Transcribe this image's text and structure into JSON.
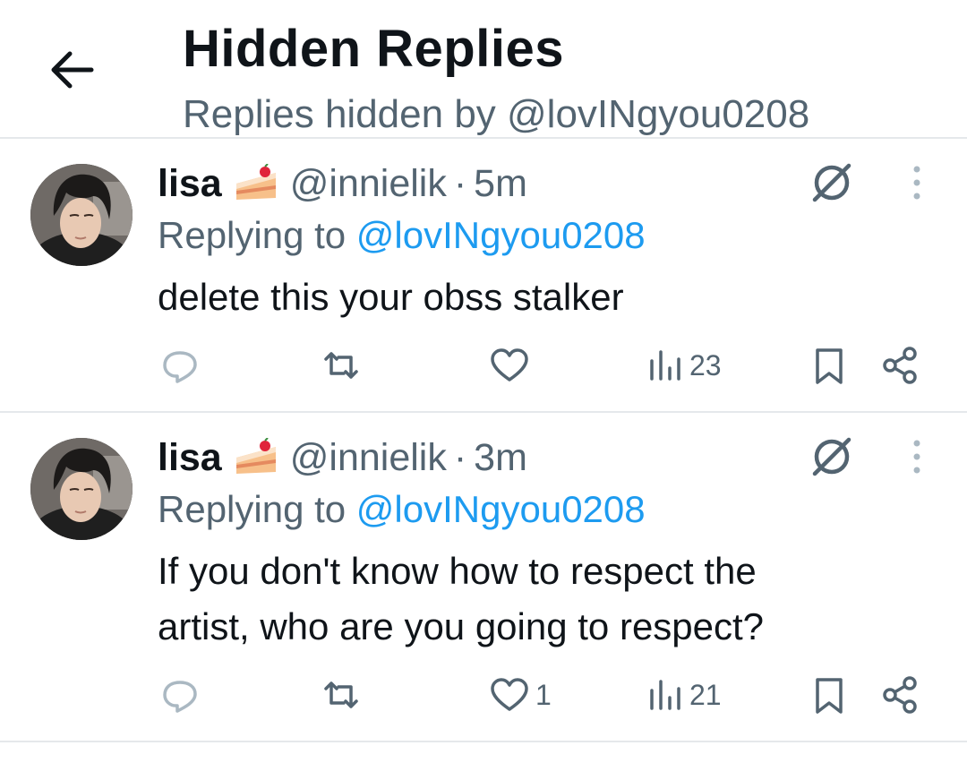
{
  "header": {
    "title": "Hidden Replies",
    "subtitle": "Replies hidden by @lovINgyou0208",
    "back_icon": "arrow-left-icon"
  },
  "posts": [
    {
      "name": "lisa",
      "emoji_icon": "cake-icon",
      "handle": "@innielik",
      "separator": "·",
      "time": "5m",
      "replying_prefix": "Replying to ",
      "replying_to": "@lovINgyou0208",
      "text": "delete this your obss stalker",
      "likes": "",
      "views": "23"
    },
    {
      "name": "lisa",
      "emoji_icon": "cake-icon",
      "handle": "@innielik",
      "separator": "·",
      "time": "3m",
      "replying_prefix": "Replying to ",
      "replying_to": "@lovINgyou0208",
      "text": "If you don't know how to respect the artist, who are you going to respect?",
      "likes": "1",
      "views": "21"
    }
  ],
  "colors": {
    "text": "#0f1419",
    "secondary": "#536471",
    "mention": "#1d9bf0",
    "divider": "#e5e8eb"
  }
}
